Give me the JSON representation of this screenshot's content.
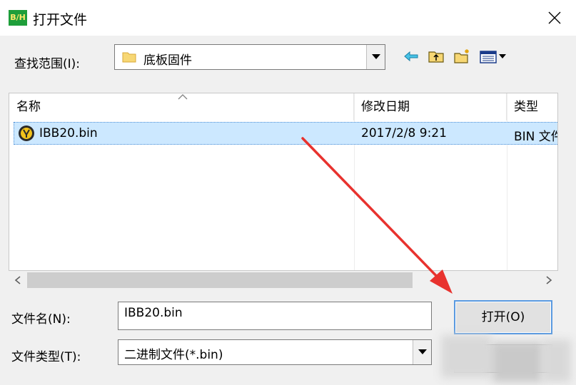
{
  "window": {
    "title": "打开文件",
    "app_icon_text": "B/H"
  },
  "lookin": {
    "label": "查找范围(I):",
    "value": "底板固件"
  },
  "toolbar": {
    "icons": [
      "back-arrow-icon",
      "up-folder-icon",
      "new-folder-icon",
      "view-menu-icon"
    ]
  },
  "file_list": {
    "columns": [
      {
        "label": "名称"
      },
      {
        "label": "修改日期"
      },
      {
        "label": "类型"
      }
    ],
    "rows": [
      {
        "name": "IBB20.bin",
        "modified": "2017/2/8 9:21",
        "type": "BIN 文件"
      }
    ]
  },
  "filename": {
    "label": "文件名(N):",
    "value": "IBB20.bin"
  },
  "filetype": {
    "label": "文件类型(T):",
    "value": "二进制文件(*.bin)"
  },
  "buttons": {
    "open_label": "打开(O)"
  },
  "colors": {
    "selection": "#cce8ff",
    "annotation_arrow": "#e8322e",
    "app_icon_bg": "#1e9e3a"
  }
}
